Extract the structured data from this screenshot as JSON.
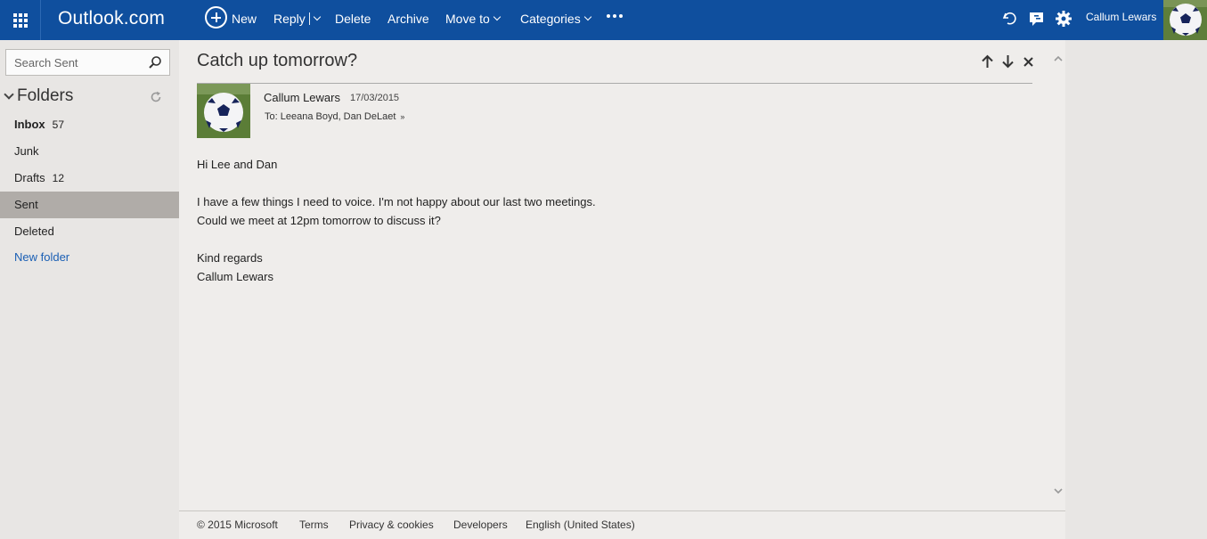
{
  "header": {
    "app_title": "Outlook.com",
    "commands": {
      "new": "New",
      "reply": "Reply",
      "delete": "Delete",
      "archive": "Archive",
      "move_to": "Move to",
      "categories": "Categories"
    },
    "user_name": "Callum Lewars",
    "bar_color": "#0f4f9e",
    "icons": [
      "waffle-icon",
      "new-plus-icon",
      "more-icon",
      "undo-icon",
      "chat-icon",
      "gear-icon",
      "avatar"
    ]
  },
  "sidebar": {
    "search_placeholder": "Search Sent",
    "folders_heading": "Folders",
    "folders": [
      {
        "name": "Inbox",
        "count": "57",
        "bold": true
      },
      {
        "name": "Junk",
        "count": ""
      },
      {
        "name": "Drafts",
        "count": "12"
      },
      {
        "name": "Sent",
        "count": "",
        "selected": true
      },
      {
        "name": "Deleted",
        "count": ""
      },
      {
        "name": "New folder",
        "count": "",
        "link": true
      }
    ],
    "selected_color": "#b0aca8"
  },
  "message": {
    "subject": "Catch up tomorrow?",
    "sender": "Callum Lewars",
    "date": "17/03/2015",
    "to": "To: Leeana Boyd, Dan DeLaet",
    "body": [
      "Hi Lee and Dan",
      "I have a few things I need to voice. I'm not happy about our last two meetings.",
      "Could we meet at 12pm tomorrow to discuss it?",
      "Kind regards",
      "Callum Lewars"
    ]
  },
  "footer": {
    "copyright": "© 2015 Microsoft",
    "terms": "Terms",
    "privacy": "Privacy & cookies",
    "developers": "Developers",
    "language": "English (United States)"
  }
}
